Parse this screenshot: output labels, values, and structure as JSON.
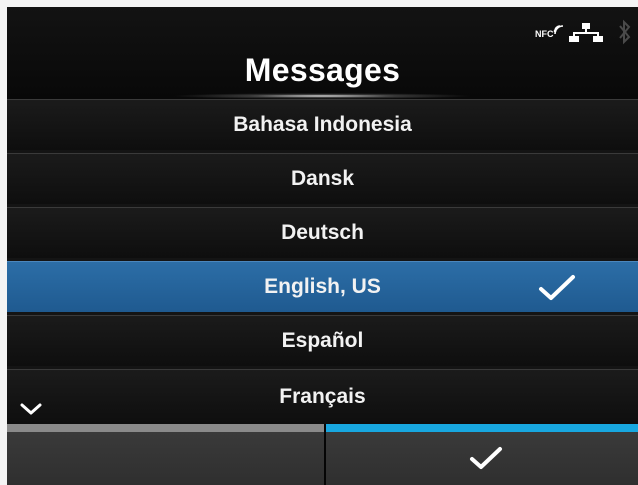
{
  "header": {
    "title": "Messages",
    "status_icons": [
      "nfc-icon",
      "network-icon",
      "bluetooth-icon"
    ],
    "nfc_label": "NFC"
  },
  "language_list": {
    "items": [
      {
        "label": "Bahasa Indonesia",
        "selected": false
      },
      {
        "label": "Dansk",
        "selected": false
      },
      {
        "label": "Deutsch",
        "selected": false
      },
      {
        "label": "English, US",
        "selected": true
      },
      {
        "label": "Español",
        "selected": false
      },
      {
        "label": "Français",
        "selected": false
      }
    ],
    "more_below_icon": "chevron-down-icon"
  },
  "footer": {
    "back_button": {
      "icon": "none"
    },
    "confirm_button": {
      "icon": "checkmark-icon"
    }
  },
  "colors": {
    "selected_row": "#2568a0",
    "confirm_accent": "#18a7e0",
    "back_accent": "#8a8a8a",
    "text": "#f2f2f2"
  }
}
